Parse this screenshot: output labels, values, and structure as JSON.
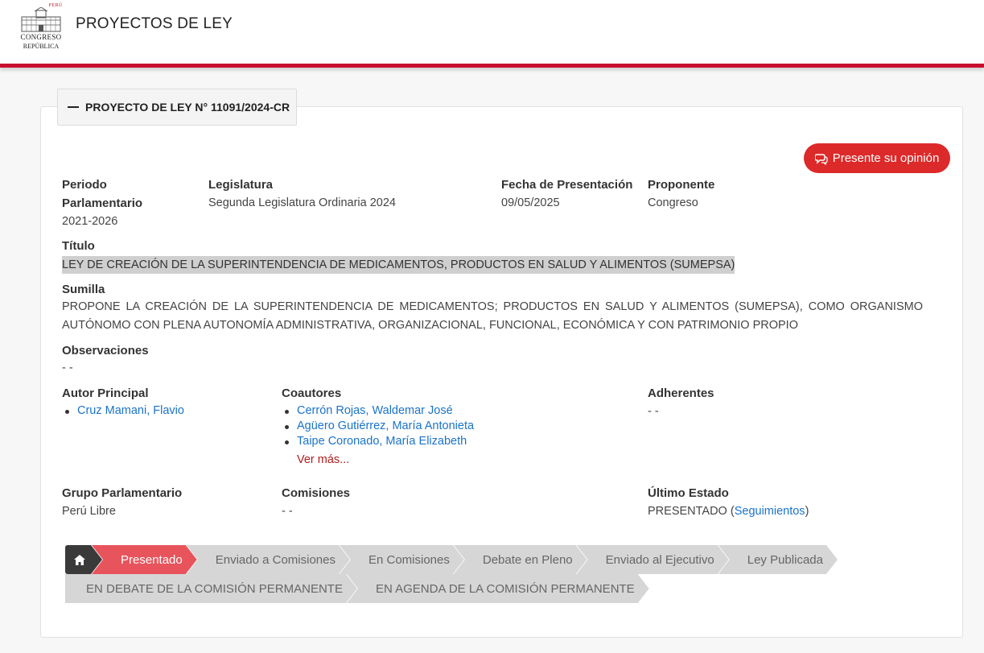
{
  "header": {
    "logo_peru": "PERÚ",
    "logo_congreso": "CONGRESO",
    "logo_republica": "REPÚBLICA",
    "title": "PROYECTOS DE LEY"
  },
  "project": {
    "legend": "PROYECTO DE LEY N° 11091/2024-CR",
    "opinion_button": "Presente su opinión",
    "fields": {
      "periodo_label_1": "Periodo",
      "periodo_label_2": "Parlamentario",
      "periodo_value": "2021-2026",
      "legislatura_label": "Legislatura",
      "legislatura_value": "Segunda Legislatura Ordinaria 2024",
      "fecha_label": "Fecha de Presentación",
      "fecha_value": "09/05/2025",
      "proponente_label": "Proponente",
      "proponente_value": "Congreso",
      "titulo_label": "Título",
      "titulo_value": "LEY DE CREACIÓN DE LA SUPERINTENDENCIA DE MEDICAMENTOS, PRODUCTOS EN SALUD Y ALIMENTOS (SUMEPSA)",
      "sumilla_label": "Sumilla",
      "sumilla_value": "PROPONE LA CREACIÓN DE LA SUPERINTENDENCIA DE MEDICAMENTOS; PRODUCTOS EN SALUD Y ALIMENTOS (SUMEPSA), COMO ORGANISMO AUTÓNOMO CON PLENA AUTONOMÍA ADMINISTRATIVA, ORGANIZACIONAL, FUNCIONAL, ECONÓMICA Y CON PATRIMONIO PROPIO",
      "observaciones_label": "Observaciones",
      "observaciones_value": "- -",
      "autor_label": "Autor Principal",
      "autores": [
        "Cruz Mamani, Flavio"
      ],
      "coautores_label": "Coautores",
      "coautores": [
        "Cerrón Rojas, Waldemar José",
        "Agüero Gutiérrez, María Antonieta",
        "Taipe Coronado, María Elizabeth"
      ],
      "ver_mas": "Ver más...",
      "adherentes_label": "Adherentes",
      "adherentes_value": "- -",
      "grupo_label": "Grupo Parlamentario",
      "grupo_value": "Perú Libre",
      "comisiones_label": "Comisiones",
      "comisiones_value": "- -",
      "estado_label": "Último Estado",
      "estado_value": "PRESENTADO (",
      "estado_link": "Seguimientos",
      "estado_close": ")"
    },
    "steps_row1": [
      "Presentado",
      "Enviado a Comisiones",
      "En Comisiones",
      "Debate en Pleno",
      "Enviado al Ejecutivo",
      "Ley Publicada"
    ],
    "steps_row2": [
      "EN DEBATE DE LA COMISIÓN PERMANENTE",
      "EN AGENDA DE LA COMISIÓN PERMANENTE"
    ],
    "active_step": "Presentado"
  },
  "colors": {
    "brand_red": "#c8102e",
    "button_red": "#dc2a2a",
    "active_step": "#e8545c",
    "link_blue": "#1a73c9"
  }
}
